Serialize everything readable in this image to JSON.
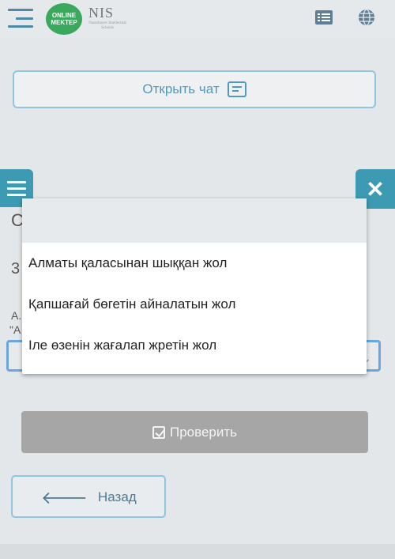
{
  "header": {
    "logo_online_mektep": "ONLINE MEKTEP",
    "logo_nis": "NIS",
    "logo_nis_subtitle": "Nazarbayev Intellectual Schools",
    "icons": [
      "menu-toggle-icon",
      "list-icon",
      "globe-icon"
    ]
  },
  "chat": {
    "label": "Открыть чат"
  },
  "background": {
    "heading_fragment": "С",
    "number_fragment": "3",
    "text_fragment_1": "А.",
    "text_fragment_2": "\"А"
  },
  "dropdown": {
    "options": [
      "",
      "Алматы қаласынан шыққан жол",
      "Қапшағай бөгетін айналатын жол",
      "Іле өзенін жағалап жретін жол"
    ]
  },
  "actions": {
    "check_label": "Проверить",
    "back_label": "Назад"
  },
  "colors": {
    "accent": "#3c9ab2",
    "border": "#8ec6e0",
    "disabled": "#a6a6a6",
    "brand_green": "#3aa85d"
  }
}
